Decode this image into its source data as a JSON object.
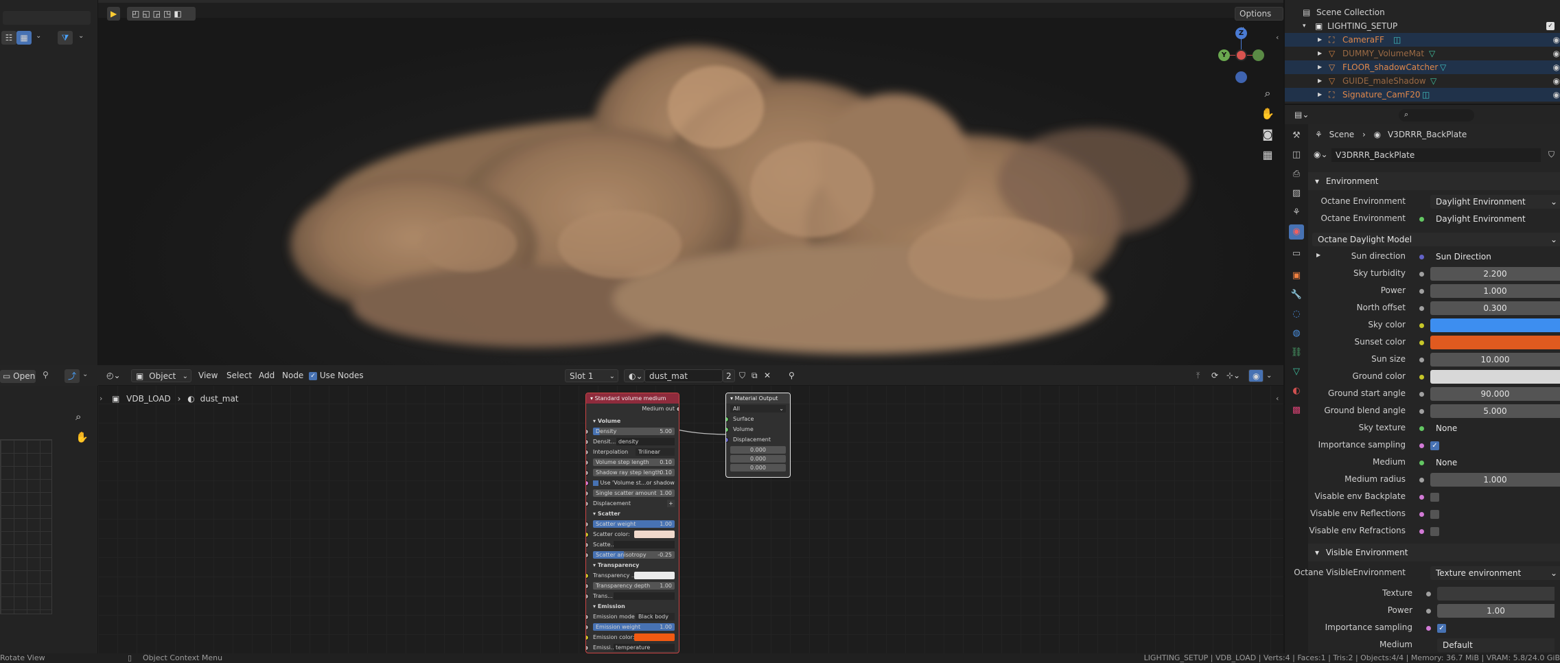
{
  "viewport": {
    "options_label": "Options",
    "gizmo": {
      "z": "Z",
      "y": "Y"
    }
  },
  "left_strip": {
    "open_label": "Open"
  },
  "node_editor": {
    "editor_type": "Object",
    "menu": {
      "view": "View",
      "select": "Select",
      "add": "Add",
      "node": "Node"
    },
    "use_nodes_label": "Use Nodes",
    "slot": "Slot 1",
    "material_name": "dust_mat",
    "user_count": "2",
    "breadcrumb": {
      "object": "VDB_LOAD",
      "material": "dust_mat"
    },
    "volume_node": {
      "title": "Standard volume medium",
      "output": "Medium out",
      "sections": {
        "volume": "Volume",
        "scatter": "Scatter",
        "transparency": "Transparency",
        "emission": "Emission"
      },
      "rows": {
        "density": "Density",
        "density_val": "5.00",
        "density_grid": "Densit...",
        "density_grid_val": "density",
        "interpolation": "Interpolation",
        "interpolation_val": "Trilinear",
        "volume_step": "Volume step length",
        "volume_step_val": "0.10",
        "shadow_step": "Shadow ray step length",
        "shadow_step_val": "0.10",
        "use_volume_step": "Use 'Volume st...or shadow rays",
        "single_scatter": "Single scatter amount",
        "single_scatter_val": "1.00",
        "displacement": "Displacement",
        "scatter_weight": "Scatter weight",
        "scatter_weight_val": "1.00",
        "scatter_color": "Scatter color:",
        "scatter_grid": "Scatte...",
        "scatter_aniso": "Scatter anisotropy",
        "scatter_aniso_val": "-0.25",
        "transparency_color": "Transparency ...",
        "transparency_depth": "Transparency depth",
        "transparency_depth_val": "1.00",
        "trans_grid": "Trans...",
        "emission_mode": "Emission mode",
        "emission_mode_val": "Black body",
        "emission_weight": "Emission weight",
        "emission_weight_val": "1.00",
        "emission_color": "Emission color:",
        "emission_grid": "Emissi...",
        "emission_grid_val": "temperature"
      }
    },
    "output_node": {
      "title": "Material Output",
      "target": "All",
      "surface": "Surface",
      "volume": "Volume",
      "displacement": "Displacement",
      "values": [
        "0.000",
        "0.000",
        "0.000"
      ]
    }
  },
  "outliner": {
    "collection": "Scene Collection",
    "root": "LIGHTING_SETUP",
    "items": [
      {
        "name": "CameraFF",
        "icon": "camera-icon"
      },
      {
        "name": "DUMMY_VolumeMat",
        "icon": "mesh-icon"
      },
      {
        "name": "FLOOR_shadowCatcher",
        "icon": "mesh-icon"
      },
      {
        "name": "GUIDE_maleShadow",
        "icon": "mesh-icon"
      },
      {
        "name": "Signature_CamF20",
        "icon": "camera-icon"
      }
    ]
  },
  "properties": {
    "breadcrumb": {
      "scene": "Scene",
      "world": "V3DRRR_BackPlate"
    },
    "world_name": "V3DRRR_BackPlate",
    "environment": {
      "header": "Environment",
      "octane_env_label": "Octane Environment",
      "octane_env_val": "Daylight Environment",
      "octane_env_label2": "Octane Environment",
      "octane_env_val2": "Daylight Environment",
      "daylight_model": "Octane Daylight Model",
      "sun_direction": "Sun direction",
      "sun_direction_val": "Sun Direction",
      "sky_turbidity": "Sky turbidity",
      "sky_turbidity_val": "2.200",
      "power": "Power",
      "power_val": "1.000",
      "north_offset": "North offset",
      "north_offset_val": "0.300",
      "sky_color": "Sky color",
      "sky_color_hex": "#3d8ef0",
      "sunset_color": "Sunset color",
      "sunset_color_hex": "#e05a1f",
      "sun_size": "Sun size",
      "sun_size_val": "10.000",
      "ground_color": "Ground color",
      "ground_color_hex": "#d8d8d8",
      "ground_start": "Ground start angle",
      "ground_start_val": "90.000",
      "ground_blend": "Ground blend angle",
      "ground_blend_val": "5.000",
      "sky_texture": "Sky texture",
      "sky_texture_val": "None",
      "importance": "Importance sampling",
      "medium": "Medium",
      "medium_val": "None",
      "medium_radius": "Medium radius",
      "medium_radius_val": "1.000",
      "vis_backplate": "Visable env Backplate",
      "vis_reflections": "Visable env Reflections",
      "vis_refractions": "Visable env Refractions"
    },
    "visible_env": {
      "header": "Visible Environment",
      "octane_vis_label": "Octane VisibleEnvironment",
      "octane_vis_val": "Texture environment",
      "texture": "Texture",
      "power": "Power",
      "power_val": "1.00",
      "importance": "Importance sampling",
      "medium": "Medium",
      "medium_val": "Default"
    }
  },
  "status_bar": {
    "left": "Rotate View",
    "middle": "Object Context Menu",
    "right": "LIGHTING_SETUP | VDB_LOAD | Verts:4 | Faces:1 | Tris:2 | Objects:4/4 | Memory: 36.7 MiB | VRAM: 5.8/24.0 GiB"
  }
}
